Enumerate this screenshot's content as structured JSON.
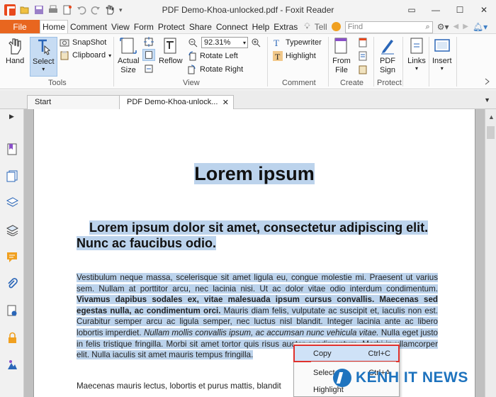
{
  "window": {
    "title": "PDF Demo-Khoa-unlocked.pdf - Foxit Reader"
  },
  "ribbon_tabs": {
    "file": "File",
    "tabs": [
      "Home",
      "Comment",
      "View",
      "Form",
      "Protect",
      "Share",
      "Connect",
      "Help",
      "Extras"
    ],
    "tell": "Tell",
    "find_placeholder": "Find"
  },
  "ribbon": {
    "tools": {
      "hand": "Hand",
      "select": "Select",
      "snapshot": "SnapShot",
      "clipboard": "Clipboard",
      "group": "Tools"
    },
    "view": {
      "actual_size": "Actual Size",
      "reflow": "Reflow",
      "zoom": "92.31%",
      "rotate_left": "Rotate Left",
      "rotate_right": "Rotate Right",
      "group": "View"
    },
    "comment": {
      "typewriter": "Typewriter",
      "highlight": "Highlight",
      "group": "Comment"
    },
    "create": {
      "from_file": "From File",
      "group": "Create"
    },
    "protect": {
      "pdf_sign": "PDF Sign",
      "group": "Protect"
    },
    "links": "Links",
    "insert": "Insert"
  },
  "doc_tabs": {
    "start": "Start",
    "active": "PDF Demo-Khoa-unlock..."
  },
  "document": {
    "title": "Lorem ipsum",
    "subtitle": "Lorem ipsum dolor sit amet, consectetur adipiscing elit. Nunc ac faucibus odio.",
    "para1_a": "Vestibulum neque massa, scelerisque sit amet ligula eu, congue molestie mi. Praesent ut varius sem. Nullam at porttitor arcu, nec lacinia nisi. Ut ac dolor vitae odio interdum condimentum. ",
    "para1_b": "Vivamus dapibus sodales ex, vitae malesuada ipsum cursus convallis. Maecenas sed egestas nulla, ac condimentum orci.",
    "para1_c": " Mauris diam felis, vulputate ac suscipit et, iaculis non est. Curabitur semper arcu ac ligula semper, nec luctus nisl blandit. Integer lacinia ante ac libero lobortis imperdiet. ",
    "para1_d": "Nullam mollis convallis ipsum, ac accumsan nunc vehicula vitae.",
    "para1_e": " Nulla eget justo in felis tristique fringilla. Morbi sit amet tortor quis risus auctor condimentum. Morbi in ullamcorper elit. Nulla iaculis sit amet mauris tempus fringilla.",
    "para2": "Maecenas mauris lectus, lobortis et purus mattis, blandit"
  },
  "context_menu": {
    "copy": "Copy",
    "copy_shortcut": "Ctrl+C",
    "select_all": "Select All",
    "select_all_shortcut": "Ctrl+A",
    "highlight": "Highlight"
  },
  "watermark": {
    "text": "KENH IT NEWS"
  },
  "colors": {
    "file_tab": "#e8661f",
    "selection": "#bcd3ec",
    "menu_highlight_border": "#e0312c",
    "watermark": "#1e73be"
  }
}
